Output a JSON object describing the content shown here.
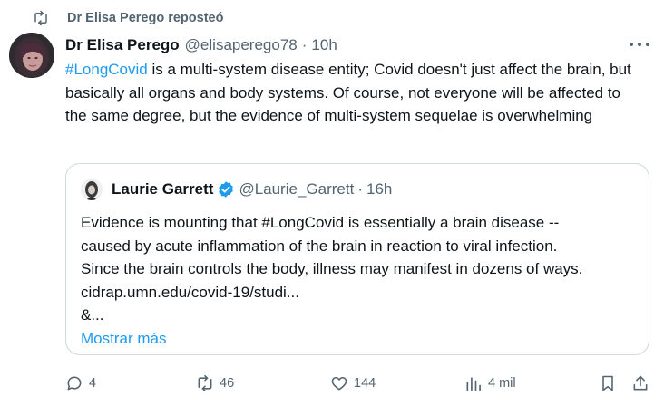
{
  "repost": {
    "text": "Dr Elisa Perego reposteó",
    "icon": "repost-icon"
  },
  "tweet": {
    "author_name": "Dr Elisa Perego",
    "author_handle": "@elisaperego78",
    "separator": "·",
    "time": "10h",
    "text_hashtag": "#LongCovid",
    "text_rest": " is a multi-system disease entity; Covid doesn't just affect the brain, but basically all organs and body systems. Of course, not everyone will be affected to the same degree, but the evidence of multi-system sequelae is overwhelming"
  },
  "quote": {
    "author_name": "Laurie Garrett",
    "author_handle": "@Laurie_Garrett",
    "separator": "·",
    "time": "16h",
    "lines": [
      "Evidence is mounting that #LongCovid is essentially a brain disease --",
      "caused by acute inflammation of the brain in reaction to viral infection.",
      "Since the brain controls the body, illness may manifest in dozens of ways.",
      "cidrap.umn.edu/covid-19/studi...",
      "&..."
    ],
    "show_more": "Mostrar más"
  },
  "actions": {
    "replies": "4",
    "reposts": "46",
    "likes": "144",
    "views": "4 mil"
  },
  "colors": {
    "accent": "#1d9bf0",
    "muted": "#536471",
    "text": "#0f1419",
    "border": "#cfd9de"
  }
}
